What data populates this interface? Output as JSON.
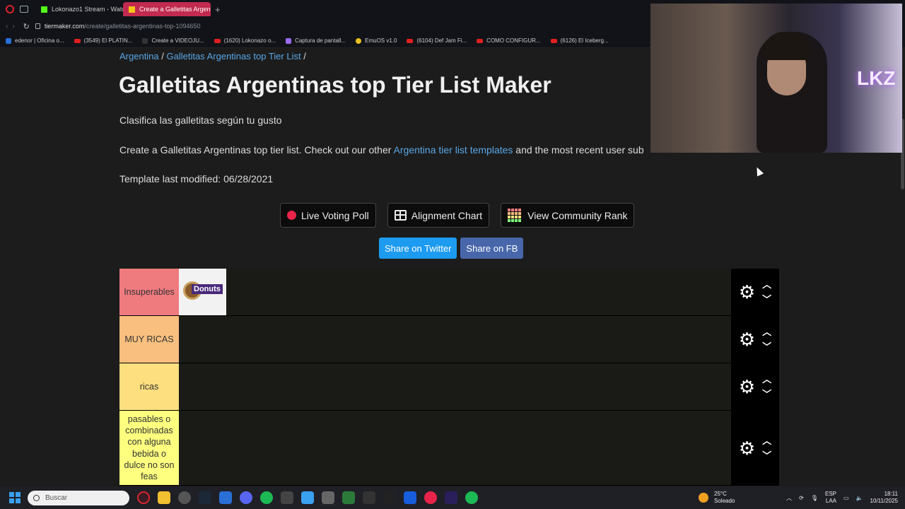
{
  "browser": {
    "tabs": [
      {
        "label": "Lokonazo1 Stream - Watc",
        "active": false,
        "favicon_color": "#53fc18"
      },
      {
        "label": "Create a Galletitas Argent",
        "active": true,
        "favicon_color": "#f5c518"
      }
    ],
    "url_host": "tiermaker.com",
    "url_path": "/create/galletitas-argentinas-top-1094650",
    "bookmarks": [
      {
        "label": "edenor | Oficina o...",
        "icon": "edenor-icon"
      },
      {
        "label": "(3549) El PLATIN...",
        "icon": "youtube-icon"
      },
      {
        "label": "Create a VIDEOJU...",
        "icon": "tiermaker-icon"
      },
      {
        "label": "(1620) Lokonazo o...",
        "icon": "youtube-icon"
      },
      {
        "label": "Captura de pantall...",
        "icon": "pen-icon"
      },
      {
        "label": "EmuOS v1.0",
        "icon": "emuos-icon"
      },
      {
        "label": "(6104) Def Jam Fi...",
        "icon": "youtube-icon"
      },
      {
        "label": "COMO CONFIGUR...",
        "icon": "youtube-icon"
      },
      {
        "label": "(6126) El Iceberg...",
        "icon": "youtube-icon"
      }
    ]
  },
  "page": {
    "breadcrumb_1": "Argentina",
    "breadcrumb_sep": "/",
    "breadcrumb_2": "Galletitas Argentinas top Tier List",
    "title": "Galletitas Argentinas top Tier List Maker",
    "subtitle": "Clasifica las galletitas según tu gusto",
    "desc_before": "Create a Galletitas Argentinas top tier list. Check out our other ",
    "desc_link": "Argentina tier list templates",
    "desc_after": " and the most recent user sub",
    "modified": "Template last modified: 06/28/2021",
    "buttons": {
      "live_voting": "Live Voting Poll",
      "alignment": "Alignment Chart",
      "community": "View Community Rank",
      "twitter": "Share on Twitter",
      "facebook": "Share on FB"
    }
  },
  "tiers": [
    {
      "label": "Insuperables",
      "color": "#f07b7f",
      "items": [
        "Donuts"
      ]
    },
    {
      "label": "MUY RICAS",
      "color": "#f8bf7f",
      "items": []
    },
    {
      "label": "ricas",
      "color": "#fddf7f",
      "items": []
    },
    {
      "label": "pasables o combinadas con alguna bebida o dulce no son feas",
      "color": "#feff7f",
      "items": []
    }
  ],
  "webcam": {
    "neon_text": "LKZ"
  },
  "taskbar": {
    "search_placeholder": "Buscar",
    "weather_temp": "25°C",
    "weather_desc": "Soleado",
    "lang_1": "ESP",
    "lang_2": "LAA",
    "time": "18:11",
    "date": "10/11/2025"
  }
}
